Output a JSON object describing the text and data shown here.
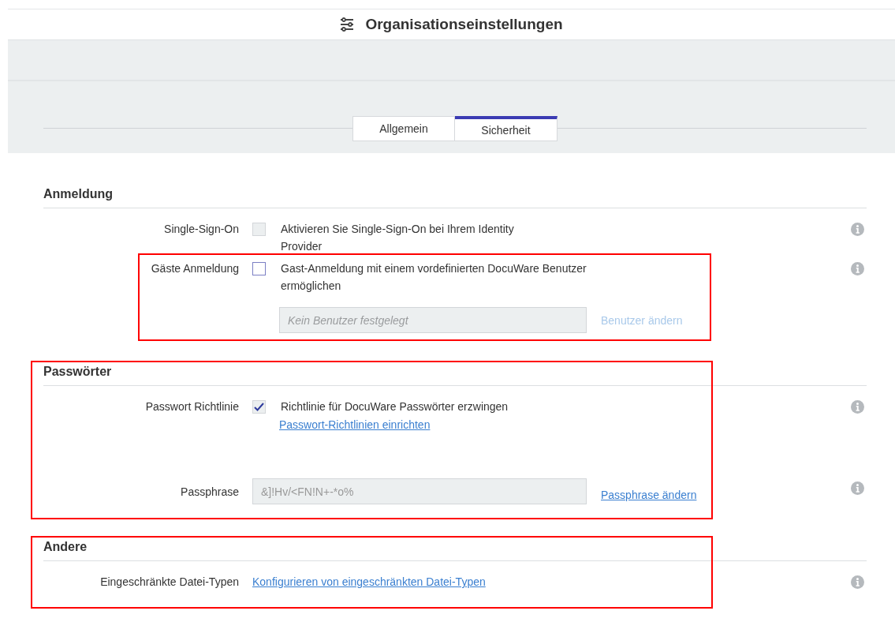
{
  "header": {
    "title": "Organisationseinstellungen"
  },
  "tabs": [
    {
      "label": "Allgemein",
      "selected": false
    },
    {
      "label": "Sicherheit",
      "selected": true
    }
  ],
  "sections": [
    {
      "title": "Anmeldung",
      "rows": [
        {
          "kind": "checkbox",
          "label": "Single-Sign-On",
          "checked": false,
          "disabled": true,
          "text": "Aktivieren Sie Single-Sign-On bei Ihrem Identity Provider"
        },
        {
          "kind": "checkbox",
          "label": "Gäste Anmeldung",
          "checked": false,
          "disabled": false,
          "text": "Gast-Anmeldung mit einem vordefinierten DocuWare Benutzer ermöglichen",
          "highlighted": true,
          "field": {
            "placeholder": "Kein Benutzer festgelegt"
          },
          "action": {
            "label": "Benutzer ändern",
            "disabled": true
          }
        }
      ]
    },
    {
      "title": "Passwörter",
      "highlighted": true,
      "rows": [
        {
          "kind": "checkbox",
          "label": "Passwort Richtlinie",
          "checked": true,
          "text": "Richtlinie für DocuWare Passwörter erzwingen",
          "link": "Passwort-Richtlinien einrichten"
        },
        {
          "kind": "input",
          "label": "Passphrase",
          "value": "&]!Hv/<FN!N+-*o%",
          "action": {
            "label": "Passphrase ändern",
            "disabled": false
          }
        }
      ]
    },
    {
      "title": "Andere",
      "highlighted": true,
      "rows": [
        {
          "kind": "link",
          "label": "Eingeschränkte Datei-Typen",
          "link": "Konfigurieren von eingeschränkten Datei-Typen"
        }
      ]
    }
  ]
}
